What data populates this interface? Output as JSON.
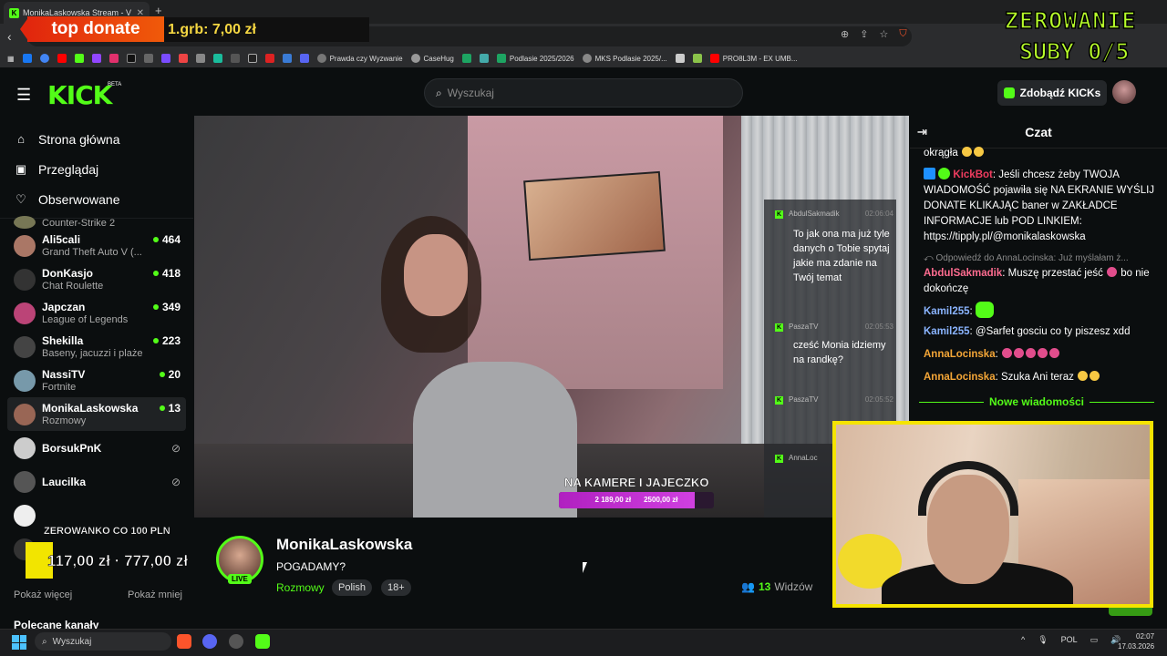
{
  "browser": {
    "tab_title": "MonikaLaskowska Stream - V",
    "bookmarks": [
      "Prawda czy Wyzwanie",
      "CaseHug",
      "Podlasie 2025/2026",
      "MKS Podlasie 2025/...",
      "PRO8L3M - EX UMB..."
    ]
  },
  "overlay": {
    "top_donate_label": "top donate",
    "top_donate_value": "1.grb: 7,00 zł",
    "zero_title": "ZEROWANIE",
    "zero_sub": "SUBY 0/5",
    "zero_left_label": "ZEROWANKO CO 100 PLN",
    "zero_left_value": "117,00 zł · 777,00 zł"
  },
  "header": {
    "logo": "KICK",
    "logo_badge": "BETA",
    "search_placeholder": "Wyszukaj",
    "kicks_button": "Zdobądź KICKs"
  },
  "sidebar": {
    "nav": [
      {
        "label": "Strona główna",
        "icon": "home-icon"
      },
      {
        "label": "Przeglądaj",
        "icon": "browse-icon"
      },
      {
        "label": "Obserwowane",
        "icon": "heart-icon"
      }
    ],
    "channels": [
      {
        "name": "Ali5cali",
        "category": "Grand Theft Auto V (...",
        "viewers": "464"
      },
      {
        "name": "DonKasjo",
        "category": "Chat Roulette",
        "viewers": "418"
      },
      {
        "name": "Japczan",
        "category": "League of Legends",
        "viewers": "349"
      },
      {
        "name": "Shekilla",
        "category": "Baseny, jacuzzi i plaże",
        "viewers": "223"
      },
      {
        "name": "NassiTV",
        "category": "Fortnite",
        "viewers": "20"
      },
      {
        "name": "MonikaLaskowska",
        "category": "Rozmowy",
        "viewers": "13"
      }
    ],
    "offline_channels": [
      "BorsukPnK",
      "Laucilka"
    ],
    "partial_top": {
      "category": "Counter-Strike 2"
    },
    "show_more": "Pokaż więcej",
    "show_less": "Pokaż mniej",
    "recommended": "Polecane kanały"
  },
  "video": {
    "chat_overlay": [
      {
        "user": "AbdulSakmadik",
        "time": "02:06:04",
        "text": "To jak ona ma już tyle danych o Tobie spytaj jakie ma zdanie na Twój temat"
      },
      {
        "user": "PaszaTV",
        "time": "02:05:53",
        "text": "cześć Monia idziemy na randkę?"
      },
      {
        "user": "PaszaTV",
        "time": "02:05:52",
        "text": ""
      },
      {
        "user": "AnnaLoc",
        "time": "",
        "text": ""
      }
    ],
    "goal_label": "NA KAMERE I JAJECZKO",
    "goal_current": "2 189,00 zł",
    "goal_target": "2500,00 zł",
    "goal_progress": 0.876
  },
  "stream": {
    "streamer": "MonikaLaskowska",
    "live_badge": "LIVE",
    "title": "POGADAMY?",
    "category": "Rozmowy",
    "tags": [
      "Polish",
      "18+"
    ],
    "viewers_count": "13",
    "viewers_label": "Widzów"
  },
  "chat": {
    "title": "Czat",
    "top_partial": "okrągła",
    "messages": [
      {
        "user": "KickBot",
        "text": "Jeśli chcesz żeby TWOJA WIADOMOŚĆ pojawiła się NA EKRANIE WYŚLIJ DONATE KLIKAJĄC baner w ZAKŁADCE INFORMACJE lub POD LINKIEM: https://tipply.pl/@monikalaskowska"
      },
      {
        "reply": "Odpowiedź do AnnaLocinska: Już myślałam ż...",
        "user": "AbdulSakmadik",
        "text": "Muszę przestać jeść",
        "text2": "bo nie dokończę"
      },
      {
        "user": "Kamil255",
        "text": ""
      },
      {
        "user": "Kamil255",
        "text": "@Sarfet gosciu co ty piszesz xdd"
      },
      {
        "user": "AnnaLocinska",
        "text": ""
      },
      {
        "user": "AnnaLocinska",
        "text": "Szuka Ani teraz"
      }
    ],
    "new_messages": "Nowe wiadomości"
  },
  "taskbar": {
    "search": "Wyszukaj",
    "lang": "POL",
    "time": "02:07",
    "date": "17.03.2026"
  },
  "colors": {
    "kick_green": "#53fc18",
    "bg": "#0b0e0f",
    "donate_red": "#e1260d",
    "overlay_lime": "#b8ff2a"
  }
}
